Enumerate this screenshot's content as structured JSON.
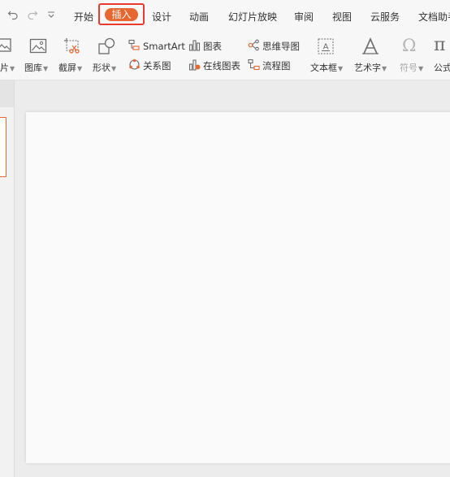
{
  "quick_access": {
    "undo_icon": "undo-icon",
    "redo_icon": "redo-icon",
    "customize_icon": "dropdown-caret-icon"
  },
  "menu": {
    "tabs": [
      "开始",
      "插入",
      "设计",
      "动画",
      "幻灯片放映",
      "审阅",
      "视图",
      "云服务",
      "文档助手"
    ],
    "active_tab": "插入",
    "highlight_color": "#e83a2f",
    "active_pill_color": "#e8662f"
  },
  "ribbon": {
    "picture_label": "片",
    "gallery_label": "图库",
    "screenshot_label": "截屏",
    "shapes_label": "形状",
    "relation_label": "关系图",
    "smartart_label": "SmartArt",
    "chart_label": "图表",
    "online_chart_label": "在线图表",
    "mindmap_label": "思维导图",
    "flowchart_label": "流程图",
    "textbox_label": "文本框",
    "wordart_label": "艺术字",
    "symbol_label": "符号",
    "formula_label": "公式"
  }
}
